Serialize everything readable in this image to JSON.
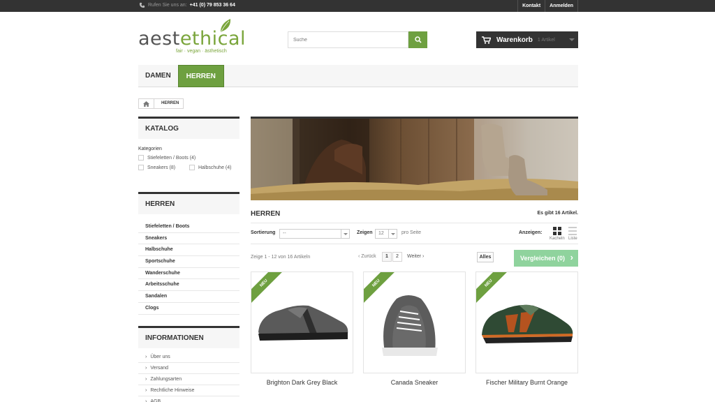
{
  "topbar": {
    "call_label": "Rufen Sie uns an:",
    "phone": "+41 (0) 79 853 36 64",
    "links": [
      "Kontakt",
      "Anmelden"
    ]
  },
  "logo": {
    "brand_main": "aest",
    "brand_accent": "ethical",
    "tagline": "fair · vegan · ästhetisch"
  },
  "search": {
    "placeholder": "Suche"
  },
  "cart": {
    "label": "Warenkorb",
    "count": "1 Artikel"
  },
  "nav": {
    "items": [
      "DAMEN",
      "HERREN"
    ],
    "active": "HERREN"
  },
  "breadcrumb": {
    "current": "HERREN"
  },
  "sidebar": {
    "catalog": {
      "title": "KATALOG",
      "categories_label": "Kategorien",
      "filters": [
        "Stiefeletten / Boots (4)",
        "Sneakers (8)",
        "Halbschuhe (4)"
      ]
    },
    "herren": {
      "title": "HERREN",
      "items": [
        "Stiefeletten / Boots",
        "Sneakers",
        "Halbschuhe",
        "Sportschuhe",
        "Wanderschuhe",
        "Arbeitsschuhe",
        "Sandalen",
        "Clogs"
      ]
    },
    "info": {
      "title": "INFORMATIONEN",
      "items": [
        "Über uns",
        "Versand",
        "Zahlungsarten",
        "Rechtliche Hinweise",
        "AGB"
      ]
    }
  },
  "main": {
    "title": "HERREN",
    "count": "Es gibt 16 Artikel.",
    "sort_label": "Sortierung",
    "sort_value": "--",
    "show_label": "Zeigen",
    "show_value": "12",
    "per_page": "pro Seite",
    "view_label": "Anzeigen:",
    "view_grid": "Kacheln",
    "view_list": "Liste",
    "showing": "Zeige 1 - 12 von 16 Artikeln",
    "back": "Zurück",
    "pages": [
      "1",
      "2"
    ],
    "next": "Weiter",
    "all": "Alles",
    "compare": "Vergleichen (0)"
  },
  "products": [
    {
      "name": "Brighton Dark Grey Black",
      "badge": "NEU"
    },
    {
      "name": "Canada Sneaker",
      "badge": "NEU"
    },
    {
      "name": "Fischer Military Burnt Orange",
      "badge": "NEU"
    }
  ],
  "colors": {
    "accent": "#6ea040",
    "dark": "#333333",
    "compare": "#8fd39d"
  }
}
